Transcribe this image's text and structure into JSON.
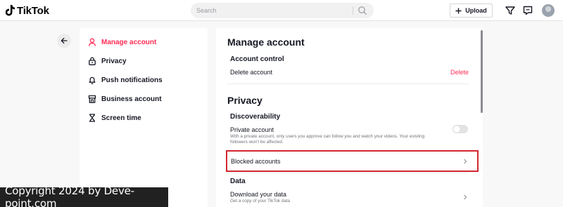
{
  "header": {
    "logo_text": "TikTok",
    "search_placeholder": "Search",
    "upload_label": "Upload"
  },
  "sidebar": {
    "items": [
      {
        "label": "Manage account",
        "icon": "person-icon",
        "active": true
      },
      {
        "label": "Privacy",
        "icon": "lock-icon",
        "active": false
      },
      {
        "label": "Push notifications",
        "icon": "bell-icon",
        "active": false
      },
      {
        "label": "Business account",
        "icon": "store-icon",
        "active": false
      },
      {
        "label": "Screen time",
        "icon": "hourglass-icon",
        "active": false
      }
    ]
  },
  "main": {
    "manage_title": "Manage account",
    "account_control_heading": "Account control",
    "delete_account_label": "Delete account",
    "delete_link": "Delete",
    "privacy_title": "Privacy",
    "discoverability_heading": "Discoverability",
    "private_account_label": "Private account",
    "private_account_desc": "With a private account, only users you approve can follow you and watch your videos. Your existing followers won't be affected.",
    "private_account_enabled": false,
    "blocked_accounts_label": "Blocked accounts",
    "data_heading": "Data",
    "download_data_label": "Download your data",
    "download_data_desc": "Get a copy of your TikTok data"
  },
  "watermark": "Copyright 2024 by Deve-point.com",
  "colors": {
    "accent": "#fe2c55",
    "highlight_border": "#d3262f",
    "background": "#f8f8f8"
  }
}
